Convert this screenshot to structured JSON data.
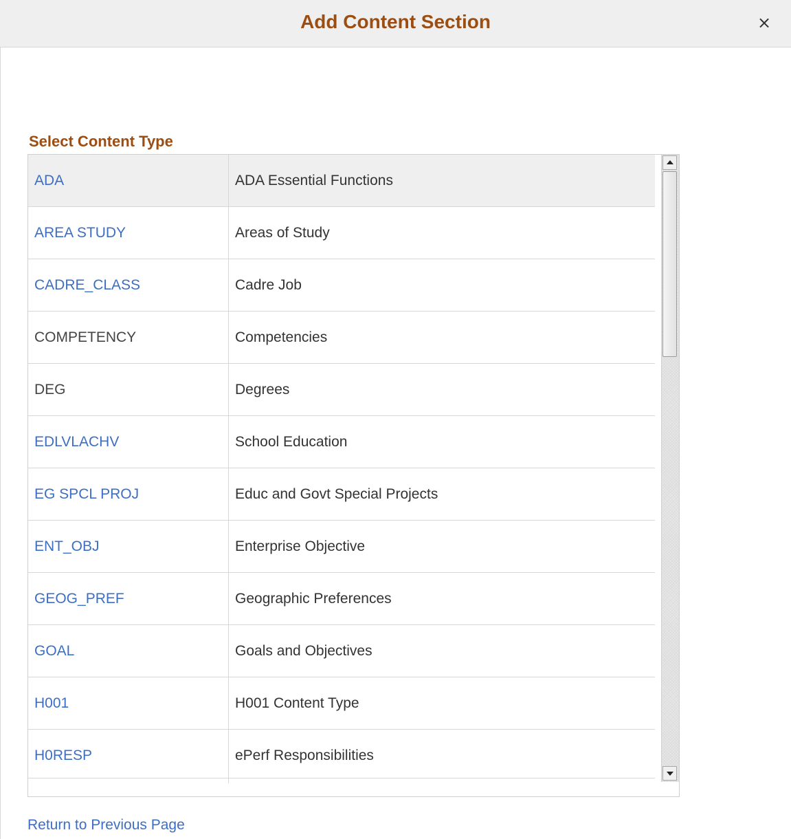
{
  "dialog": {
    "title": "Add Content Section",
    "close_symbol": "×"
  },
  "section": {
    "label": "Select Content Type"
  },
  "content_types": [
    {
      "code": "ADA",
      "description": "ADA Essential Functions",
      "link": true
    },
    {
      "code": "AREA STUDY",
      "description": "Areas of Study",
      "link": true
    },
    {
      "code": "CADRE_CLASS",
      "description": "Cadre Job",
      "link": true
    },
    {
      "code": "COMPETENCY",
      "description": "Competencies",
      "link": false
    },
    {
      "code": "DEG",
      "description": "Degrees",
      "link": false
    },
    {
      "code": "EDLVLACHV",
      "description": "School Education",
      "link": true
    },
    {
      "code": "EG SPCL PROJ",
      "description": "Educ and Govt Special Projects",
      "link": true
    },
    {
      "code": "ENT_OBJ",
      "description": "Enterprise Objective",
      "link": true
    },
    {
      "code": "GEOG_PREF",
      "description": "Geographic Preferences",
      "link": true
    },
    {
      "code": "GOAL",
      "description": "Goals and Objectives",
      "link": true
    },
    {
      "code": "H001",
      "description": "H001 Content Type",
      "link": true
    },
    {
      "code": "H0RESP",
      "description": "ePerf Responsibilities",
      "link": true
    }
  ],
  "footer": {
    "return_link": "Return to Previous Page"
  },
  "colors": {
    "title": "#9b4d12",
    "link": "#3c6fc4",
    "header_bg": "#efefef"
  },
  "icons": {
    "close": "close-icon",
    "scroll_up": "scroll-up-arrow-icon",
    "scroll_down": "scroll-down-arrow-icon"
  }
}
